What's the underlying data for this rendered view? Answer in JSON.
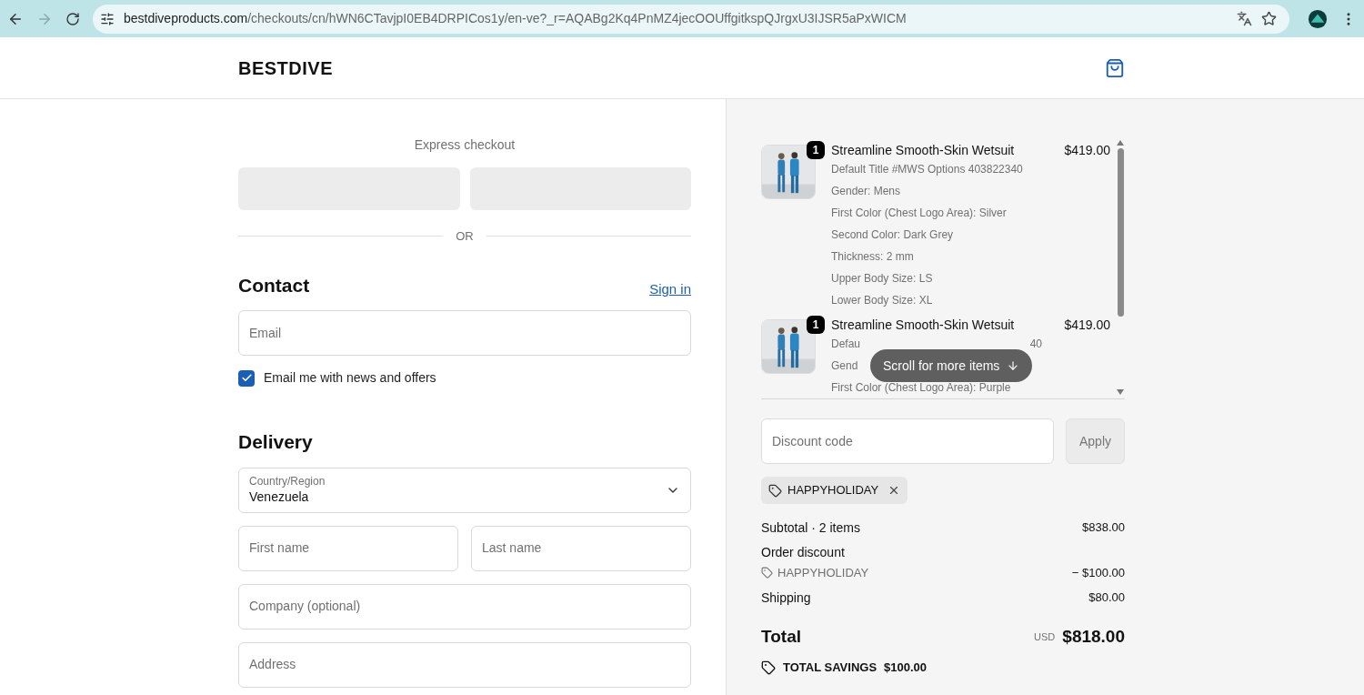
{
  "browser": {
    "url_host": "bestdiveproducts.com",
    "url_path": "/checkouts/cn/hWN6CTavjpI0EB4DRPICos1y/en-ve?_r=AQABg2Kq4PnMZ4jecOOUffgitkspQJrgxU3IJSR5aPxWICM"
  },
  "header": {
    "brand": "BESTDIVE"
  },
  "checkout": {
    "express_label": "Express checkout",
    "or_label": "OR",
    "contact": {
      "title": "Contact",
      "sign_in": "Sign in",
      "email_placeholder": "Email",
      "newsletter": {
        "label": "Email me with news and offers",
        "checked": true
      }
    },
    "delivery": {
      "title": "Delivery",
      "country_label": "Country/Region",
      "country_value": "Venezuela",
      "first_name": "First name",
      "last_name": "Last name",
      "company": "Company (optional)",
      "address": "Address"
    }
  },
  "summary": {
    "items": [
      {
        "name": "Streamline Smooth-Skin Wetsuit",
        "quantity": "1",
        "price": "$419.00",
        "details": [
          {
            "text": "Default Title #MWS Options 403822340"
          },
          {
            "text": "Gender: Mens"
          },
          {
            "text": "First Color (Chest Logo Area): Silver"
          },
          {
            "text": "Second Color: Dark Grey"
          },
          {
            "text": "Thickness: 2 mm"
          },
          {
            "text": "Upper Body Size: LS"
          },
          {
            "text": "Lower Body Size: XL"
          }
        ]
      },
      {
        "name": "Streamline Smooth-Skin Wetsuit",
        "quantity": "1",
        "price": "$419.00",
        "details": [
          {
            "text": "Defau",
            "tail": "40"
          },
          {
            "text": "Gend"
          },
          {
            "text": "First Color (Chest Logo Area): Purple"
          }
        ]
      }
    ],
    "scroll_hint": "Scroll for more items",
    "discount_placeholder": "Discount code",
    "apply": "Apply",
    "applied_code": "HAPPYHOLIDAY",
    "lines": [
      {
        "kind": "plain",
        "label": "Subtotal · 2 items",
        "value": "$838.00"
      },
      {
        "kind": "heading",
        "label": "Order discount"
      },
      {
        "kind": "code",
        "label": "HAPPYHOLIDAY",
        "value": "− $100.00"
      },
      {
        "kind": "plain",
        "label": "Shipping",
        "value": "$80.00"
      }
    ],
    "total": {
      "label": "Total",
      "currency": "USD",
      "value": "$818.00"
    },
    "savings": {
      "label": "TOTAL SAVINGS",
      "value": "$100.00"
    }
  }
}
